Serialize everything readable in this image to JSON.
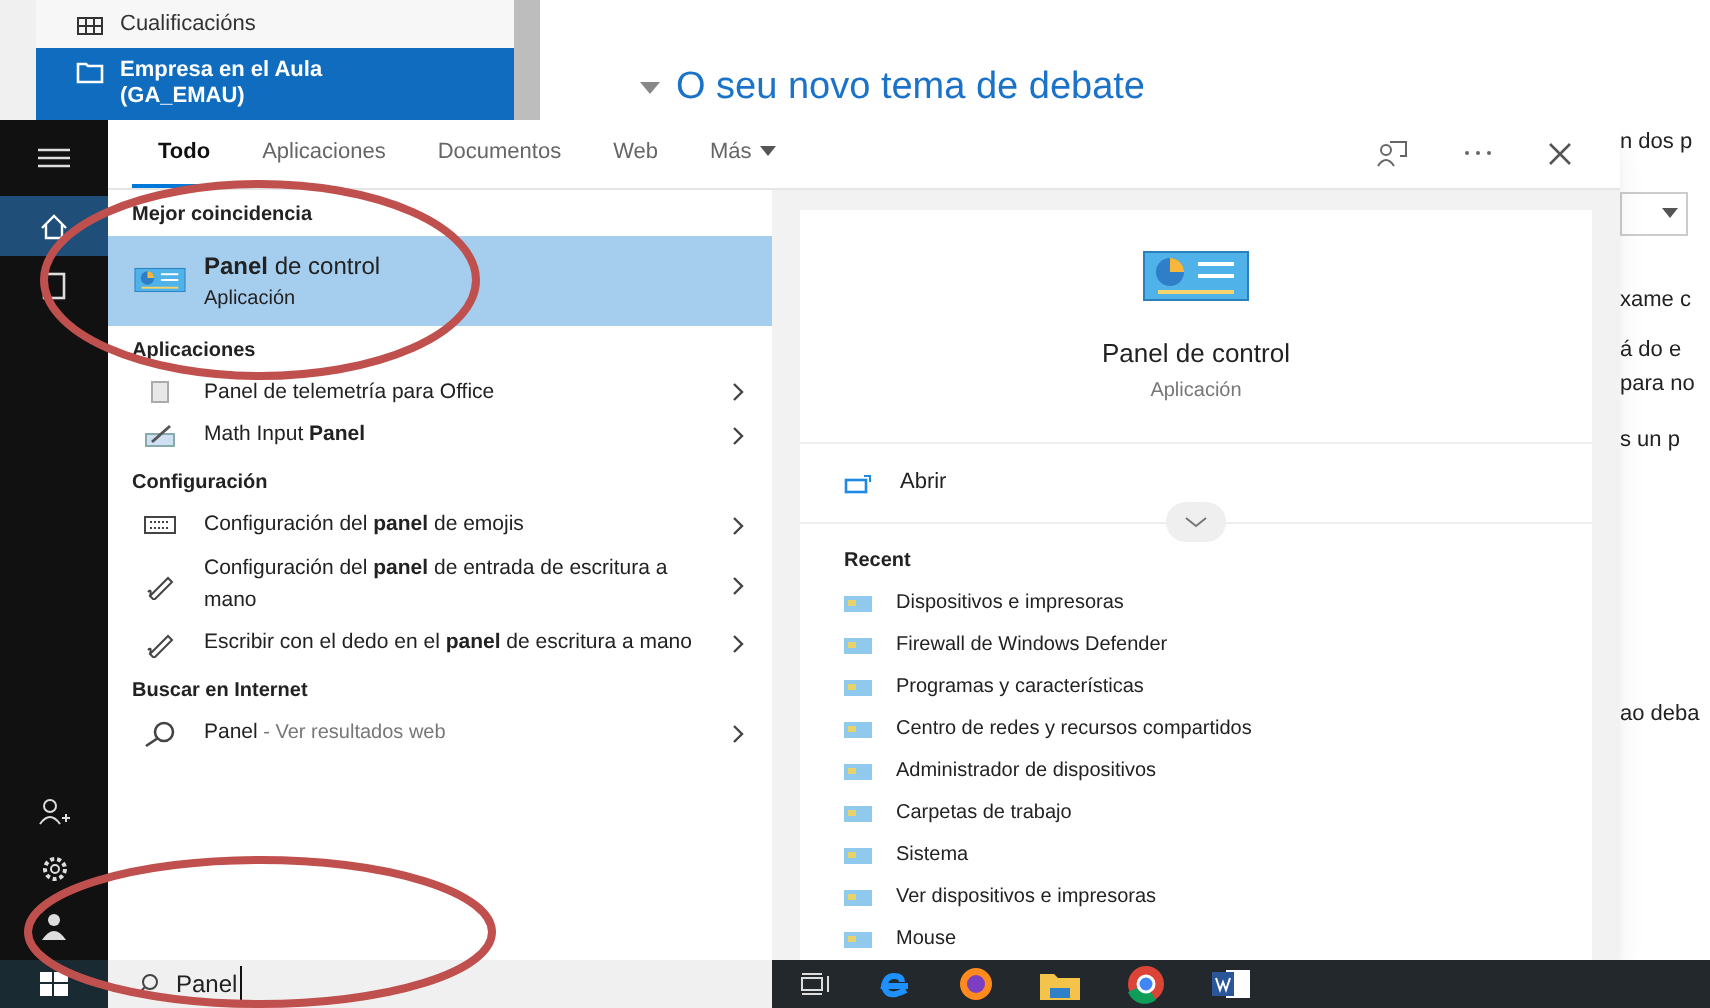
{
  "background_page": {
    "sidebar_items": [
      {
        "label": "Cualificacións",
        "selected": false
      },
      {
        "label": "Empresa en el Aula (GA_EMAU)",
        "selected": true
      }
    ],
    "heading": "O seu novo tema de debate",
    "snippets": [
      "n dos p",
      "xame c",
      "á do e",
      "para no",
      "s un p",
      "ao deba"
    ]
  },
  "search_tabs": [
    {
      "label": "Todo",
      "selected": true
    },
    {
      "label": "Aplicaciones",
      "selected": false
    },
    {
      "label": "Documentos",
      "selected": false
    },
    {
      "label": "Web",
      "selected": false
    },
    {
      "label": "Más",
      "selected": false
    }
  ],
  "results": [
    {
      "title": "Mejor coincidencia",
      "items": [
        {
          "kind": "panel",
          "label": "**Panel** de control",
          "subtitle": "Aplicación",
          "selected": true
        }
      ]
    },
    {
      "title": "Aplicaciones",
      "items": [
        {
          "kind": "document",
          "label": "Panel de telemetría para Office",
          "selected": false
        },
        {
          "kind": "math",
          "label": "Math Input **Panel**",
          "selected": false
        }
      ]
    },
    {
      "title": "Configuración",
      "items": [
        {
          "kind": "keyboard",
          "label": "Configuración del **panel** de emojis",
          "selected": false
        },
        {
          "kind": "pen",
          "label": "Configuración del **panel** de entrada de escritura a mano",
          "selected": false
        },
        {
          "kind": "pen",
          "label": "Escribir con el dedo en el **panel** de escritura a mano",
          "selected": false
        }
      ]
    },
    {
      "title": "Buscar en Internet",
      "items": [
        {
          "kind": "web",
          "label": "Panel",
          "suffix": " - Ver resultados web",
          "selected": false
        }
      ]
    }
  ],
  "preview": {
    "title": "Panel de control",
    "subtitle": "Aplicación",
    "action": "Abrir",
    "recent_title": "Recent",
    "recent": [
      "Dispositivos e impresoras",
      "Firewall de Windows Defender",
      "Programas y características",
      "Centro de redes y recursos compartidos",
      "Administrador de dispositivos",
      "Carpetas de trabajo",
      "Sistema",
      "Ver dispositivos e impresoras",
      "Mouse"
    ]
  },
  "search_box": {
    "value": "Panel"
  }
}
